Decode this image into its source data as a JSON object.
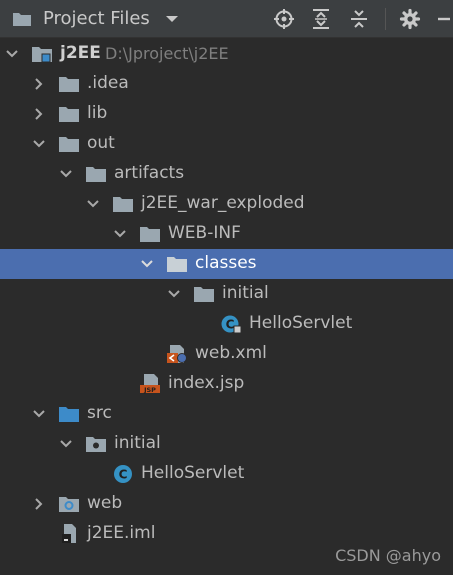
{
  "header": {
    "title": "Project Files",
    "toolbar_icons": [
      "locate-icon",
      "expand-all-icon",
      "collapse-all-icon",
      "gear-icon",
      "hide-icon"
    ]
  },
  "tree": [
    {
      "label": "j2EE",
      "path": "D:\\Jproject\\j2EE",
      "icon": "module-folder-icon",
      "expanded": true
    },
    {
      "label": ".idea",
      "icon": "folder-icon",
      "expanded": false
    },
    {
      "label": "lib",
      "icon": "folder-icon",
      "expanded": false
    },
    {
      "label": "out",
      "icon": "folder-icon",
      "expanded": true
    },
    {
      "label": "artifacts",
      "icon": "folder-icon",
      "expanded": true
    },
    {
      "label": "j2EE_war_exploded",
      "icon": "folder-icon",
      "expanded": true
    },
    {
      "label": "WEB-INF",
      "icon": "folder-icon",
      "expanded": true
    },
    {
      "label": "classes",
      "icon": "folder-icon",
      "expanded": true,
      "selected": true
    },
    {
      "label": "initial",
      "icon": "folder-icon",
      "expanded": true
    },
    {
      "label": "HelloServlet",
      "icon": "class-file-icon"
    },
    {
      "label": "web.xml",
      "icon": "web-xml-icon"
    },
    {
      "label": "index.jsp",
      "icon": "jsp-icon"
    },
    {
      "label": "src",
      "icon": "source-folder-icon",
      "expanded": true
    },
    {
      "label": "initial",
      "icon": "package-icon",
      "expanded": true
    },
    {
      "label": "HelloServlet",
      "icon": "java-class-icon"
    },
    {
      "label": "web",
      "icon": "web-folder-icon",
      "expanded": false
    },
    {
      "label": "j2EE.iml",
      "icon": "iml-file-icon"
    }
  ],
  "watermark": "CSDN @ahyo",
  "colors": {
    "background": "#2b2b2b",
    "header": "#3c3f41",
    "selection": "#4b6eaf",
    "folder": "#9aa7b0",
    "source_folder": "#3d8bc9",
    "class_icon": "#3592c4",
    "jsp_badge": "#c7541d"
  }
}
